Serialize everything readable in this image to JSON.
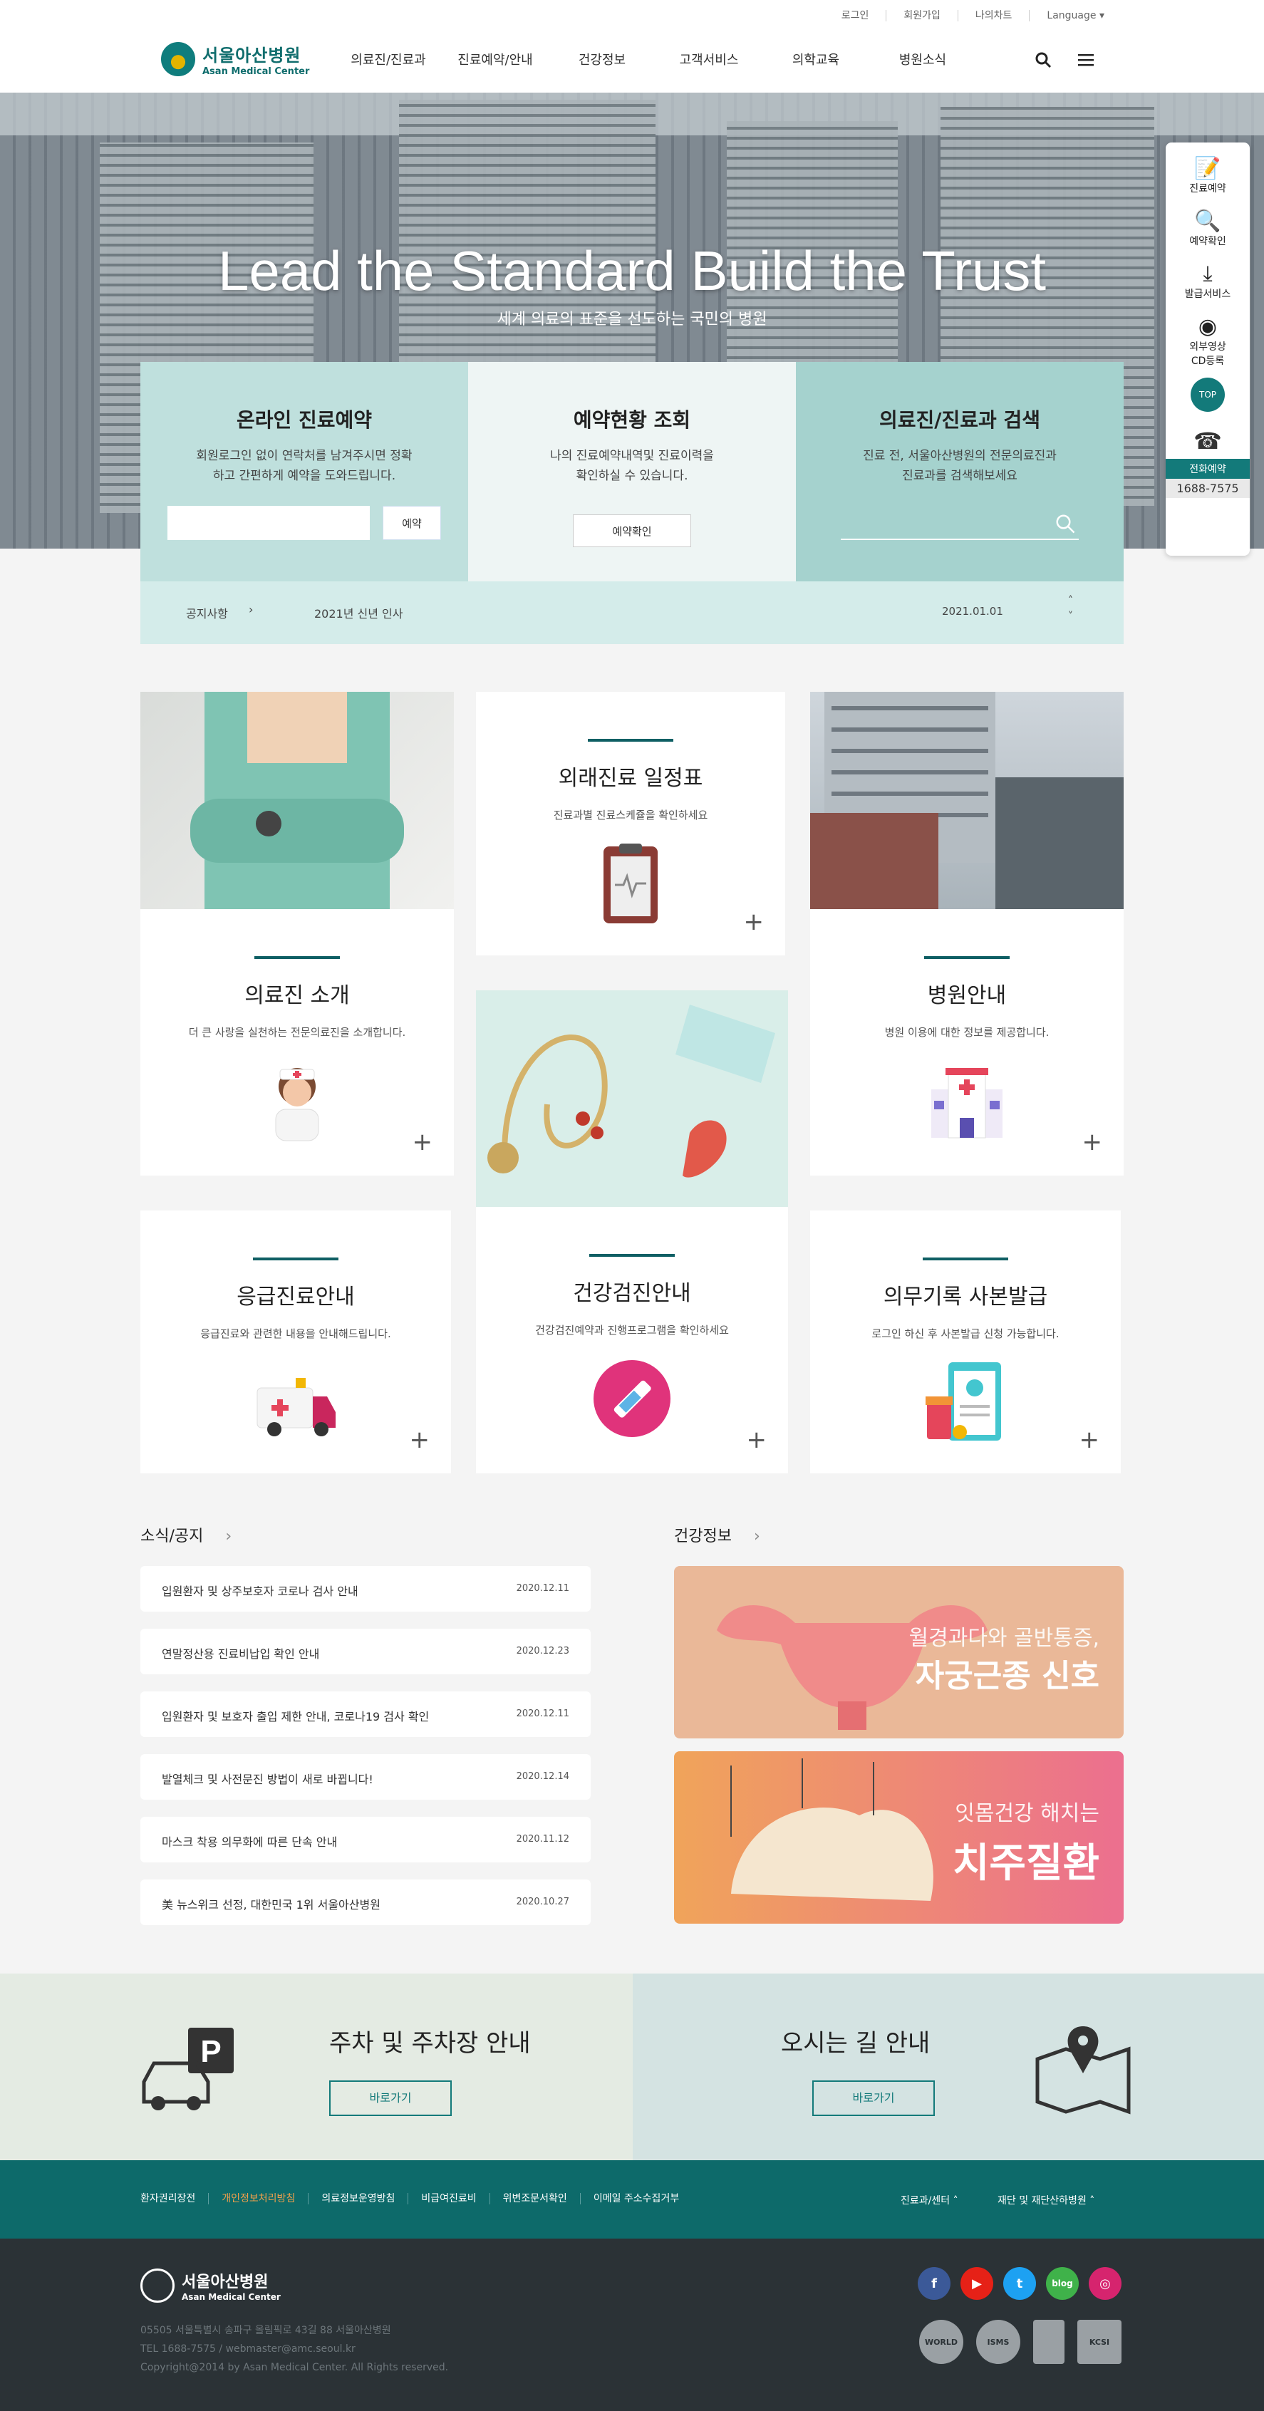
{
  "header": {
    "util_links": [
      "로그인",
      "회원가입",
      "나의차트",
      "Language ▾"
    ],
    "logo_ko": "서울아산병원",
    "logo_en": "Asan Medical Center",
    "nav": [
      "의료진/진료과",
      "진료예약/안내",
      "건강정보",
      "고객서비스",
      "의학교육",
      "병원소식"
    ]
  },
  "hero": {
    "title": "Lead the Standard Build the Trust",
    "subtitle": "세계 의료의 표준을 선도하는 국민의 병원"
  },
  "quick": {
    "items": [
      "진료예약",
      "예약확인",
      "발급서비스",
      "외부영상\nCD등록"
    ],
    "top": "TOP",
    "tel_label": "전화예약",
    "tel_number": "1688-7575"
  },
  "panels": {
    "p1": {
      "title": "온라인 진료예약",
      "desc1": "회원로그인 없이 연락처를 남겨주시면 정확",
      "desc2": "하고 간편하게 예약을 도와드립니다.",
      "button": "예약"
    },
    "p2": {
      "title": "예약현황 조회",
      "desc1": "나의 진료예약내역및 진료이력을",
      "desc2": "확인하실 수 있습니다.",
      "button": "예약확인"
    },
    "p3": {
      "title": "의료진/진료과 검색",
      "desc1": "진료 전, 서울아산병원의 전문의료진과",
      "desc2": "진료과를 검색해보세요"
    }
  },
  "notice": {
    "label": "공지사항",
    "arrow": "›",
    "title": "2021년 신년 인사",
    "date": "2021.01.01"
  },
  "cards": {
    "outpatient": {
      "title": "외래진료 일정표",
      "desc": "진료과별 진료스케쥴을 확인하세요"
    },
    "doctors": {
      "title": "의료진 소개",
      "desc": "더 큰 사랑을 실천하는 전문의료진을 소개합니다."
    },
    "hospital": {
      "title": "병원안내",
      "desc": "병원 이용에 대한 정보를 제공합니다."
    },
    "emergency": {
      "title": "응급진료안내",
      "desc": "응급진료와 관련한 내용을 안내해드립니다."
    },
    "checkup": {
      "title": "건강검진안내",
      "desc": "건강검진예약과 진행프로그램을 확인하세요"
    },
    "records": {
      "title": "의무기록 사본발급",
      "desc": "로그인 하신 후 사본발급 신청 가능합니다."
    }
  },
  "news": {
    "title": "소식/공지",
    "items": [
      {
        "t": "입원환자 및 상주보호자 코로나 검사 안내",
        "d": "2020.12.11"
      },
      {
        "t": "연말정산용 진료비납입 확인 안내",
        "d": "2020.12.23"
      },
      {
        "t": "입원환자 및 보호자 출입 제한 안내, 코로나19 검사 확인",
        "d": "2020.12.11"
      },
      {
        "t": "발열체크 및 사전문진 방법이 새로 바뀝니다!",
        "d": "2020.12.14"
      },
      {
        "t": "마스크 착용 의무화에 따른 단속 안내",
        "d": "2020.11.12"
      },
      {
        "t": "美 뉴스위크 선정, 대한민국 1위 서울아산병원",
        "d": "2020.10.27"
      }
    ]
  },
  "health": {
    "title": "건강정보",
    "b1_small": "월경과다와 골반통증,",
    "b1_big": "자궁근종 신호",
    "b2_small": "잇몸건강 해치는",
    "b2_big": "치주질환"
  },
  "bottom": {
    "parking": "주차 및 주차장 안내",
    "directions": "오시는 길 안내",
    "go": "바로가기"
  },
  "footer": {
    "links": [
      "환자권리장전",
      "개인정보처리방침",
      "의료정보운영방침",
      "비급여진료비",
      "위변조문서확인",
      "이메일 주소수집거부"
    ],
    "right1": "진료과/센터 ˄",
    "right2": "재단 및 재단산하병원 ˄",
    "logo_ko": "서울아산병원",
    "logo_en": "Asan Medical Center",
    "address": "05505 서울특별시 송파구 올림픽로 43길 88 서울아산병원",
    "tel": "TEL 1688-7575 / webmaster@amc.seoul.kr",
    "copy": "Copyright@2014 by Asan Medical Center. All Rights reserved.",
    "sns": [
      "f",
      "▶",
      "t",
      "blog",
      "◎"
    ],
    "certs": [
      "WORLD",
      "ISMS",
      "",
      "KCSI"
    ]
  },
  "colors": {
    "accent": "#137a7a",
    "highlight_link": "#f0a04b"
  }
}
